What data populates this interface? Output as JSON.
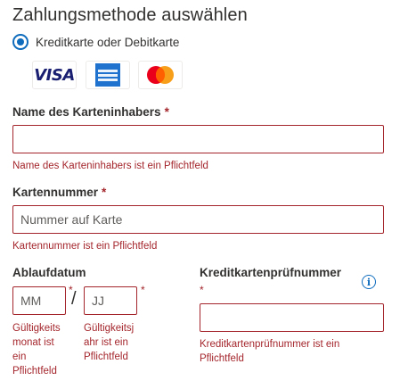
{
  "title": "Zahlungsmethode auswählen",
  "payment_option": {
    "label": "Kreditkarte oder Debitkarte",
    "selected": true
  },
  "card_logos": [
    {
      "name": "visa",
      "text": "VISA"
    },
    {
      "name": "american-express",
      "text": "AMERICAN EXPRESS"
    },
    {
      "name": "mastercard",
      "text": ""
    }
  ],
  "cardholder": {
    "label": "Name des Karteninhabers",
    "required_mark": "*",
    "value": "",
    "placeholder": "",
    "error": "Name des Karteninhabers ist ein Pflichtfeld"
  },
  "card_number": {
    "label": "Kartennummer",
    "required_mark": "*",
    "value": "",
    "placeholder": "Nummer auf Karte",
    "error": "Kartennummer ist ein Pflichtfeld"
  },
  "expiry": {
    "label": "Ablaufdatum",
    "month": {
      "placeholder": "MM",
      "required_mark": "*",
      "error_lines": [
        "Gültigkeits",
        "monat ist",
        "ein",
        "Pflichtfeld"
      ]
    },
    "separator": "/",
    "year": {
      "placeholder": "JJ",
      "required_mark": "*",
      "error_lines": [
        "Gültigkeitsj",
        "ahr ist ein",
        "Pflichtfeld"
      ]
    }
  },
  "cvv": {
    "label": "Kreditkartenprüfnummer",
    "required_mark": "*",
    "value": "",
    "info_icon": "i",
    "error_lines": [
      "Kreditkartenprüfnummer ist ein",
      "Pflichtfeld"
    ]
  },
  "colors": {
    "accent": "#0f6cbd",
    "error": "#a4262c",
    "text": "#323130"
  }
}
